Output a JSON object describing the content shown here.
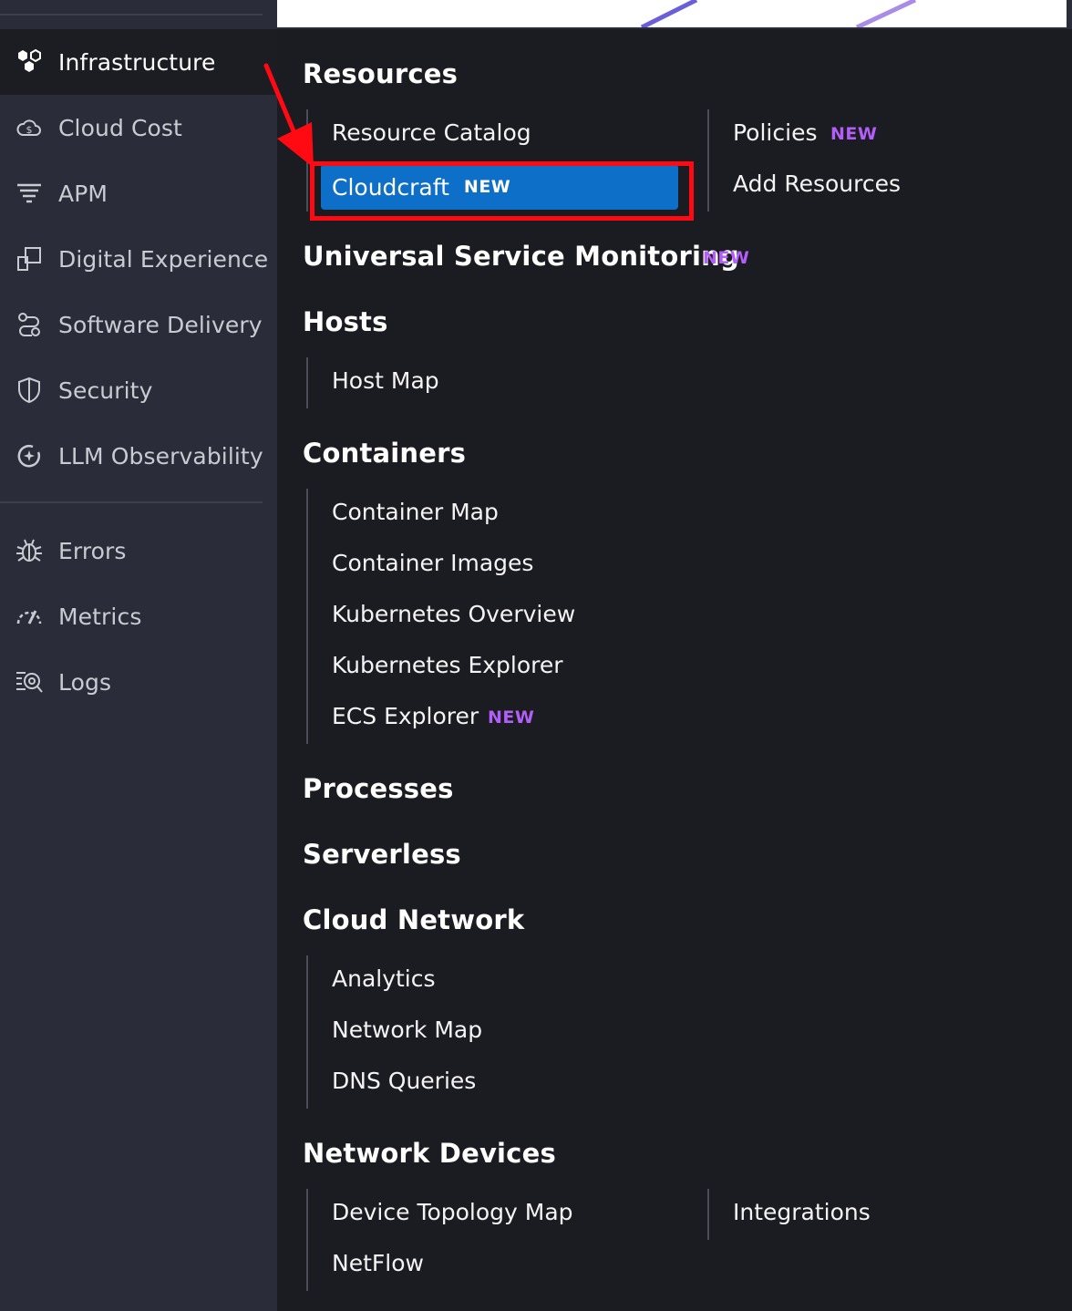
{
  "sidebar": {
    "items": [
      {
        "label": "Infrastructure",
        "icon": "hexagon-cluster-icon",
        "active": true
      },
      {
        "label": "Cloud Cost",
        "icon": "cloud-dollar-icon"
      },
      {
        "label": "APM",
        "icon": "apm-lines-icon"
      },
      {
        "label": "Digital Experience",
        "icon": "digital-experience-icon"
      },
      {
        "label": "Software Delivery",
        "icon": "software-delivery-icon"
      },
      {
        "label": "Security",
        "icon": "shield-icon"
      },
      {
        "label": "LLM Observability",
        "icon": "llm-observability-icon"
      },
      {
        "label": "Errors",
        "icon": "bug-icon"
      },
      {
        "label": "Metrics",
        "icon": "gauge-icon"
      },
      {
        "label": "Logs",
        "icon": "logs-search-icon"
      }
    ]
  },
  "flyout": {
    "new_badge": "NEW",
    "sections": {
      "resources": {
        "title": "Resources",
        "items": [
          "Resource Catalog",
          "Cloudcraft",
          "Policies",
          "Add Resources"
        ]
      },
      "usm": {
        "title": "Universal Service Monitoring"
      },
      "hosts": {
        "title": "Hosts",
        "items": [
          "Host Map"
        ]
      },
      "containers": {
        "title": "Containers",
        "items": [
          "Container Map",
          "Container Images",
          "Kubernetes Overview",
          "Kubernetes Explorer",
          "ECS Explorer"
        ]
      },
      "processes": {
        "title": "Processes"
      },
      "serverless": {
        "title": "Serverless"
      },
      "cloud_network": {
        "title": "Cloud Network",
        "items": [
          "Analytics",
          "Network Map",
          "DNS Queries"
        ]
      },
      "network_devices": {
        "title": "Network Devices",
        "items": [
          "Device Topology Map",
          "NetFlow",
          "Integrations"
        ]
      }
    }
  },
  "annotation": {
    "color": "#ff0a12",
    "target": "Cloudcraft"
  },
  "colors": {
    "sidebar_bg": "#2a2d39",
    "menu_bg": "#1b1c21",
    "highlight": "#0e6fc8",
    "new_badge": "#b35ef8"
  }
}
